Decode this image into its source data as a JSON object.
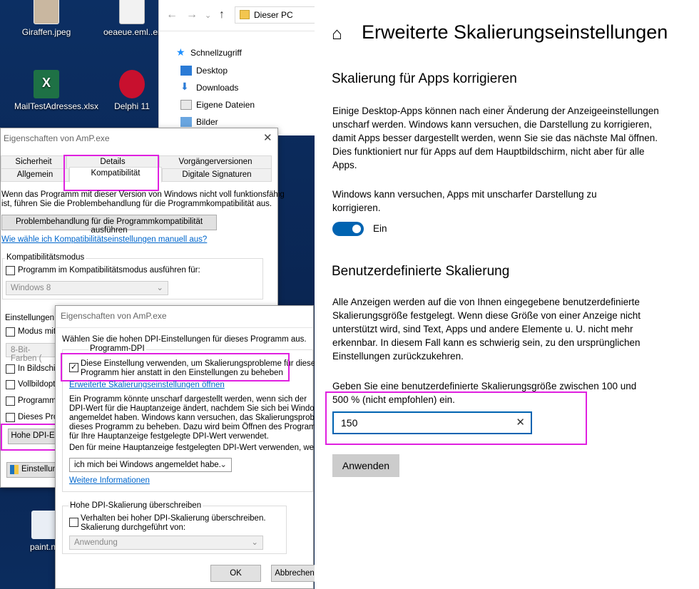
{
  "desktop": {
    "icons": [
      {
        "label": "Giraffen.jpeg"
      },
      {
        "label": "oeaeue.eml..er"
      },
      {
        "label": "MailTestAdresses.xlsx"
      },
      {
        "label": "Delphi 11"
      },
      {
        "label": "paint.n"
      }
    ]
  },
  "explorer": {
    "address": "Dieser PC",
    "tree": [
      "Schnellzugriff",
      "Desktop",
      "Downloads",
      "Eigene Dateien",
      "Bilder"
    ]
  },
  "dialog1": {
    "title": "Eigenschaften von AmP.exe",
    "tabs_row1": [
      "Sicherheit",
      "Details",
      "Vorgängerversionen"
    ],
    "tabs_row2": [
      "Allgemein",
      "Kompatibilität",
      "Digitale Signaturen"
    ],
    "intro": [
      "Wenn das Programm mit dieser Version von Windows nicht voll funktionsfähig",
      "ist, führen Sie die Problembehandlung für die Programmkompatibilität aus."
    ],
    "troubleshoot_button": "Problembehandlung für die Programmkompatibilität ausführen",
    "manual_link": "Wie wähle ich Kompatibilitätseinstellungen manuell aus?",
    "compat_group": "Kompatibilitätsmodus",
    "compat_check": "Programm im Kompatibilitätsmodus ausführen für:",
    "compat_combo": "Windows 8",
    "settings_group": "Einstellungen",
    "settings_items": [
      "Modus mit r",
      "8-Bit-Farben (",
      "In Bildschim",
      "Vollbildoptin",
      "Programm a",
      "Dieses Prog"
    ],
    "dpi_button": "Hohe DPI-E",
    "change_settings": "Einstellung"
  },
  "dialog2": {
    "title": "Eigenschaften von AmP.exe",
    "intro": "Wählen Sie die hohen DPI-Einstellungen für dieses Programm aus.",
    "group_label": "Programm-DPI",
    "check_text": [
      "Diese Einstellung verwenden, um Skalierungsprobleme für dieses",
      "Programm hier anstatt in den Einstellungen zu beheben"
    ],
    "check_mark": "✓",
    "advanced_link": "Erweiterte Skalierungseinstellungen öffnen",
    "paragraph": [
      "Ein Programm könnte unscharf dargestellt werden, wenn sich der",
      "DPI-Wert für die Hauptanzeige ändert, nachdem Sie sich bei Windows",
      "angemeldet haben. Windows kann versuchen, das Skalierungsproblem für",
      "dieses Programm zu beheben. Dazu wird beim Öffnen des Programms der",
      "für Ihre Hauptanzeige festgelegte DPI-Wert verwendet."
    ],
    "dpi_line": "Den für meine Hauptanzeige festgelegten DPI-Wert verwenden, wenn",
    "combo_value": "ich mich bei Windows angemeldet habe.",
    "more_info_link": "Weitere Informationen",
    "override_group": "Hohe DPI-Skalierung überschreiben",
    "override_check": [
      "Verhalten bei hoher DPI-Skalierung überschreiben.",
      "Skalierung durchgeführt von:"
    ],
    "override_combo": "Anwendung",
    "ok": "OK",
    "cancel": "Abbrechen"
  },
  "settings": {
    "home_icon": "⌂",
    "page_title": "Erweiterte Skalierungseinstellungen",
    "section1_title": "Skalierung für Apps korrigieren",
    "section1_text": "Einige Desktop-Apps können nach einer Änderung der Anzeigeeinstellungen unscharf werden. Windows kann versuchen, die Darstellung zu korrigieren, damit Apps besser dargestellt werden, wenn Sie sie das nächste Mal öffnen. Dies funktioniert nur für Apps auf dem Hauptbildschirm, nicht aber für alle Apps.",
    "toggle_text": "Windows kann versuchen, Apps mit unscharfer Darstellung zu korrigieren.",
    "toggle_state": "Ein",
    "section2_title": "Benutzerdefinierte Skalierung",
    "section2_text": "Alle Anzeigen werden auf die von Ihnen eingegebene benutzerdefinierte Skalierungsgröße festgelegt. Wenn diese Größe von einer Anzeige nicht unterstützt wird, sind Text, Apps und andere Elemente u. U. nicht mehr erkennbar. In diesem Fall kann es schwierig sein, zu den ursprünglichen Einstellungen zurückzukehren.",
    "input_label": "Geben Sie eine benutzerdefinierte Skalierungsgröße zwischen 100 und 500 % (nicht empfohlen) ein.",
    "input_value": "150",
    "clear_icon": "✕",
    "apply_button": "Anwenden"
  },
  "colors": {
    "accent": "#0063b1",
    "highlight": "#e020e0"
  }
}
